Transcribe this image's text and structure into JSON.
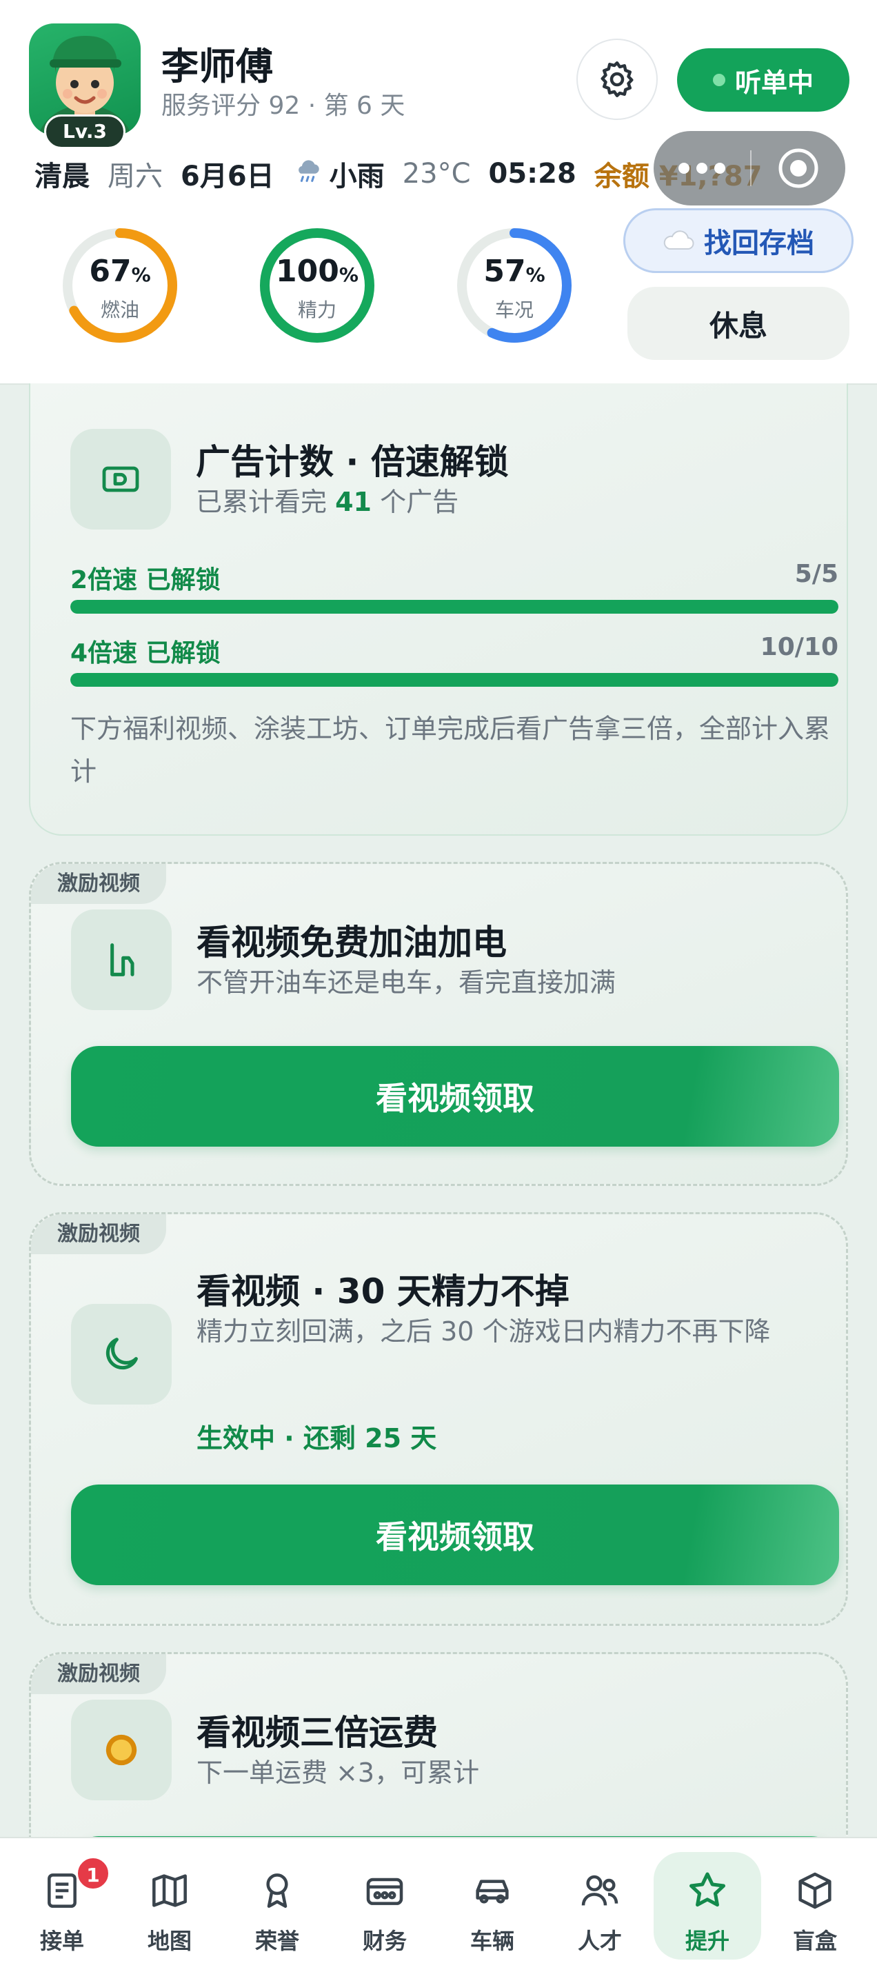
{
  "profile": {
    "name": "李师傅",
    "subtitle": "服务评分 92 · 第 6 天",
    "level": "Lv.3"
  },
  "status_button": {
    "label": "听单中"
  },
  "info_bar": {
    "period": "清晨",
    "weekday": "周六",
    "date": "6月6日",
    "weather": "小雨",
    "temperature": "23°C",
    "time": "05:28",
    "balance": "余额 ¥1,?87"
  },
  "gauges": [
    {
      "value": "67",
      "unit": "%",
      "label": "燃油",
      "level": 0.67,
      "color": "#f29a12"
    },
    {
      "value": "100",
      "unit": "%",
      "label": "精力",
      "level": 1.0,
      "color": "#15a85c"
    },
    {
      "value": "57",
      "unit": "%",
      "label": "车况",
      "level": 0.57,
      "color": "#3f84f0"
    }
  ],
  "save_button": {
    "label": "找回存档"
  },
  "rest_button": {
    "label": "休息"
  },
  "ad_counter": {
    "title": "广告计数 · 倍速解锁",
    "desc_prefix": "已累计看完",
    "count": "41",
    "desc_suffix": "个广告",
    "progress": [
      {
        "label": "2倍速 已解锁",
        "count": "5/5",
        "level": 1.0
      },
      {
        "label": "4倍速 已解锁",
        "count": "10/10",
        "level": 1.0
      }
    ],
    "note": "下方福利视频、涂装工坊、订单完成后看广告拿三倍，全部计入累计"
  },
  "video_cards": [
    {
      "tag": "激励视频",
      "icon": "fuel-pump-icon",
      "title": "看视频免费加油加电",
      "desc": "不管开油车还是电车，看完直接加满",
      "button": "看视频领取"
    },
    {
      "tag": "激励视频",
      "icon": "moon-icon",
      "title": "看视频 · 30 天精力不掉",
      "desc": "精力立刻回满，之后 30 个游戏日内精力不再下降",
      "active_note": "生效中 · 还剩 25 天",
      "button": "看视频领取"
    },
    {
      "tag": "激励视频",
      "icon": "coin-icon",
      "title": "看视频三倍运费",
      "desc": "下一单运费 ×3，可累计"
    }
  ],
  "tabs": [
    {
      "label": "接单",
      "icon": "order-list-icon",
      "badge": "1"
    },
    {
      "label": "地图",
      "icon": "map-icon"
    },
    {
      "label": "荣誉",
      "icon": "medal-icon"
    },
    {
      "label": "财务",
      "icon": "wallet-icon"
    },
    {
      "label": "车辆",
      "icon": "car-icon"
    },
    {
      "label": "人才",
      "icon": "people-icon"
    },
    {
      "label": "提升",
      "icon": "star-icon",
      "active": true
    },
    {
      "label": "盲盒",
      "icon": "box-icon"
    }
  ],
  "colors": {
    "brand_green": "#14a35a",
    "accent_gold": "#b8730f",
    "save_blue": "#2458b6",
    "badge_red": "#e53a47"
  }
}
